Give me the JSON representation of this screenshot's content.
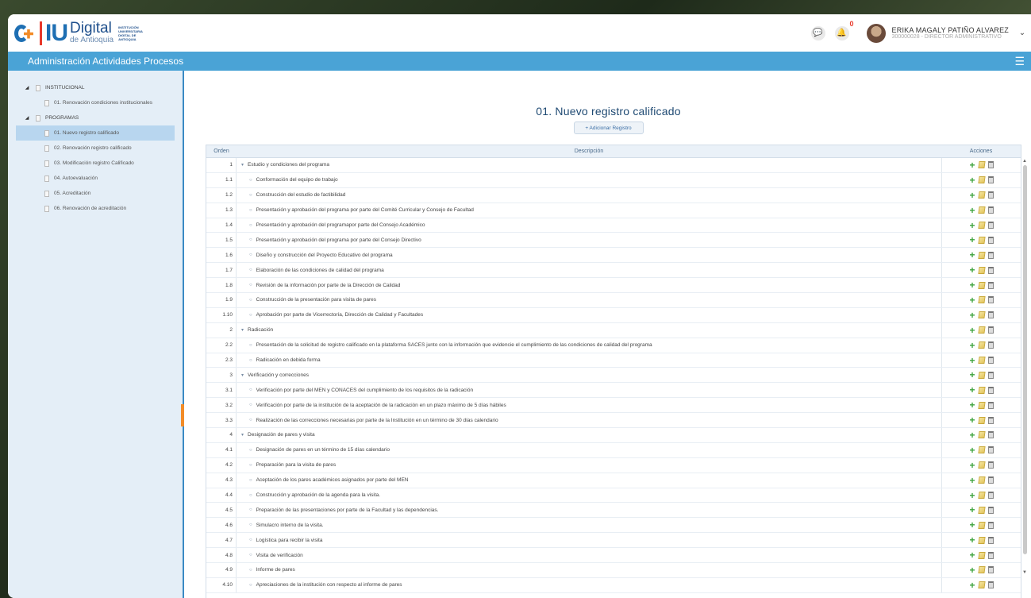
{
  "header": {
    "logo_iu": "IU",
    "logo_digital": "Digital",
    "logo_antioquia": "de Antioquia",
    "logo_institution": "INSTITUCIÓN UNIVERSITARIA DIGITAL DE ANTIOQUIA",
    "notification_count": "0",
    "user_name": "ERIKA MAGALY PATIÑO ALVAREZ",
    "user_role": "300000028 - DIRECTOR ADMINISTRATIVO"
  },
  "titlebar": {
    "title": "Administración Actividades Procesos"
  },
  "sidebar": {
    "groups": [
      {
        "label": "INSTITUCIONAL",
        "items": [
          {
            "label": "01. Renovación condiciones institucionales"
          }
        ]
      },
      {
        "label": "PROGRAMAS",
        "items": [
          {
            "label": "01. Nuevo registro calificado"
          },
          {
            "label": "02. Renovación registro calificado"
          },
          {
            "label": "03. Modificación registro Calificado"
          },
          {
            "label": "04. Autoevaluación"
          },
          {
            "label": "05. Acreditación"
          },
          {
            "label": "06. Renovación de acreditación"
          }
        ]
      }
    ]
  },
  "main": {
    "title": "01. Nuevo registro calificado",
    "add_button": "+ Adicionar Registro",
    "columns": {
      "orden": "Orden",
      "descripcion": "Descripción",
      "acciones": "Acciones"
    },
    "rows": [
      {
        "orden": "1",
        "desc": "Estudio y condiciones del programa",
        "level": 0
      },
      {
        "orden": "1.1",
        "desc": "Conformación del equipo de trabajo",
        "level": 1
      },
      {
        "orden": "1.2",
        "desc": "Construcción del estudio de factibilidad",
        "level": 1
      },
      {
        "orden": "1.3",
        "desc": "Presentación y aprobación del programa por parte del Comité Curricular y Consejo de Facultad",
        "level": 1
      },
      {
        "orden": "1.4",
        "desc": "Presentación y aprobación del programapor parte del Consejo Académico",
        "level": 1
      },
      {
        "orden": "1.5",
        "desc": "Presentación y aprobación del programa por parte del Consejo Directivo",
        "level": 1
      },
      {
        "orden": "1.6",
        "desc": "Diseño y construcción del Proyecto Educativo del programa",
        "level": 1
      },
      {
        "orden": "1.7",
        "desc": "Elaboración de las condiciones de calidad del programa",
        "level": 1
      },
      {
        "orden": "1.8",
        "desc": "Revisión de la información por parte de la Dirección de Calidad",
        "level": 1
      },
      {
        "orden": "1.9",
        "desc": "Construcción de la presentación para visita de pares",
        "level": 1
      },
      {
        "orden": "1.10",
        "desc": "Aprobación por parte de Vicerrectoría, Dirección de Calidad y Facultades",
        "level": 1
      },
      {
        "orden": "2",
        "desc": "Radicación",
        "level": 0
      },
      {
        "orden": "2.2",
        "desc": "Presentación de la solicitud de registro calificado en la plataforma SACES junto con la información que evidencie el cumplimiento de las condiciones de calidad del programa",
        "level": 1
      },
      {
        "orden": "2.3",
        "desc": "Radicación en debida forma",
        "level": 1
      },
      {
        "orden": "3",
        "desc": "Verificación y correcciones",
        "level": 0
      },
      {
        "orden": "3.1",
        "desc": "Verificación por parte del MEN y CONACES del cumplimiento de los requisitos de la radicación",
        "level": 1
      },
      {
        "orden": "3.2",
        "desc": "Verificación por parte de la institución de la aceptación de la radicación en un plazo máximo de 5 días hábiles",
        "level": 1
      },
      {
        "orden": "3.3",
        "desc": "Realización de las correcciones necesarias por parte de la Institución en un término de 30 días calendario",
        "level": 1
      },
      {
        "orden": "4",
        "desc": "Designación de pares y visita",
        "level": 0
      },
      {
        "orden": "4.1",
        "desc": "Designación de pares en un término de 15 días calendario",
        "level": 1
      },
      {
        "orden": "4.2",
        "desc": "Preparación para la visita de pares",
        "level": 1
      },
      {
        "orden": "4.3",
        "desc": "Aceptación de los pares académicos asignados por parte del MEN",
        "level": 1
      },
      {
        "orden": "4.4",
        "desc": "Construcción y aprobación de la agenda para la visita.",
        "level": 1
      },
      {
        "orden": "4.5",
        "desc": "Preparación de las presentaciones por parte de la Facultad y las dependencias.",
        "level": 1
      },
      {
        "orden": "4.6",
        "desc": "Simulacro interno de la visita.",
        "level": 1
      },
      {
        "orden": "4.7",
        "desc": "Logística para recibir la visita",
        "level": 1
      },
      {
        "orden": "4.8",
        "desc": "Visita de verificación",
        "level": 1
      },
      {
        "orden": "4.9",
        "desc": "Informe de pares",
        "level": 1
      },
      {
        "orden": "4.10",
        "desc": "Apreciaciones de la institución con respecto al informe de pares",
        "level": 1
      }
    ]
  },
  "colors": {
    "accent": "#4aa3d6",
    "sidebar_bg": "#e4eef7",
    "active_item": "#b8d6ef",
    "orange": "#f28c28"
  }
}
